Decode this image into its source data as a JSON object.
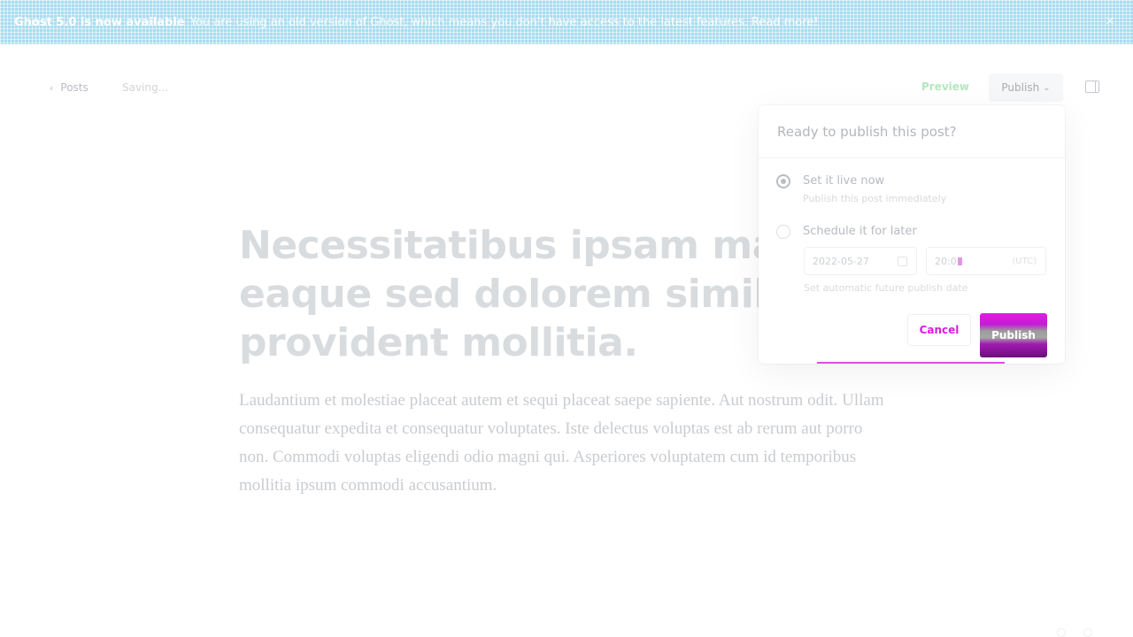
{
  "banner": {
    "headline": "Ghost 5.0 is now available",
    "message": "You are using an old version of Ghost, which means you don't have access to the latest features.",
    "link_label": "Read more!",
    "close_label": "×"
  },
  "topbar": {
    "back_label": "Posts",
    "back_icon": "chevron-left-icon",
    "status": "Saving...",
    "preview_label": "Preview",
    "publish_label": "Publish"
  },
  "post": {
    "title_lines": [
      "Necessitatibus ipsam magnam",
      "eaque sed dolorem similique",
      "provident mollitia."
    ],
    "body": "Laudantium et molestiae placeat autem et sequi placeat saepe sapiente. Aut nostrum odit. Ullam consequatur expedita et consequatur voluptates. Iste delectus voluptas est ab rerum aut porro non. Commodi voluptas eligendi odio magni qui. Asperiores voluptatem cum id temporibus mollitia ipsum commodi accusantium."
  },
  "publish_panel": {
    "heading": "Ready to publish this post?",
    "option_now": {
      "title": "Set it live now",
      "description": "Publish this post immediately"
    },
    "option_later": {
      "title": "Schedule it for later"
    },
    "date_value": "2022-05-27",
    "time_value": "20:0",
    "timezone": "(UTC)",
    "auto_link": "Set automatic future publish date",
    "cancel_label": "Cancel",
    "publish_label": "Publish"
  },
  "colors": {
    "accent": "#d61ddf",
    "banner": "#a9dcf0",
    "preview": "#b5e6bf"
  }
}
